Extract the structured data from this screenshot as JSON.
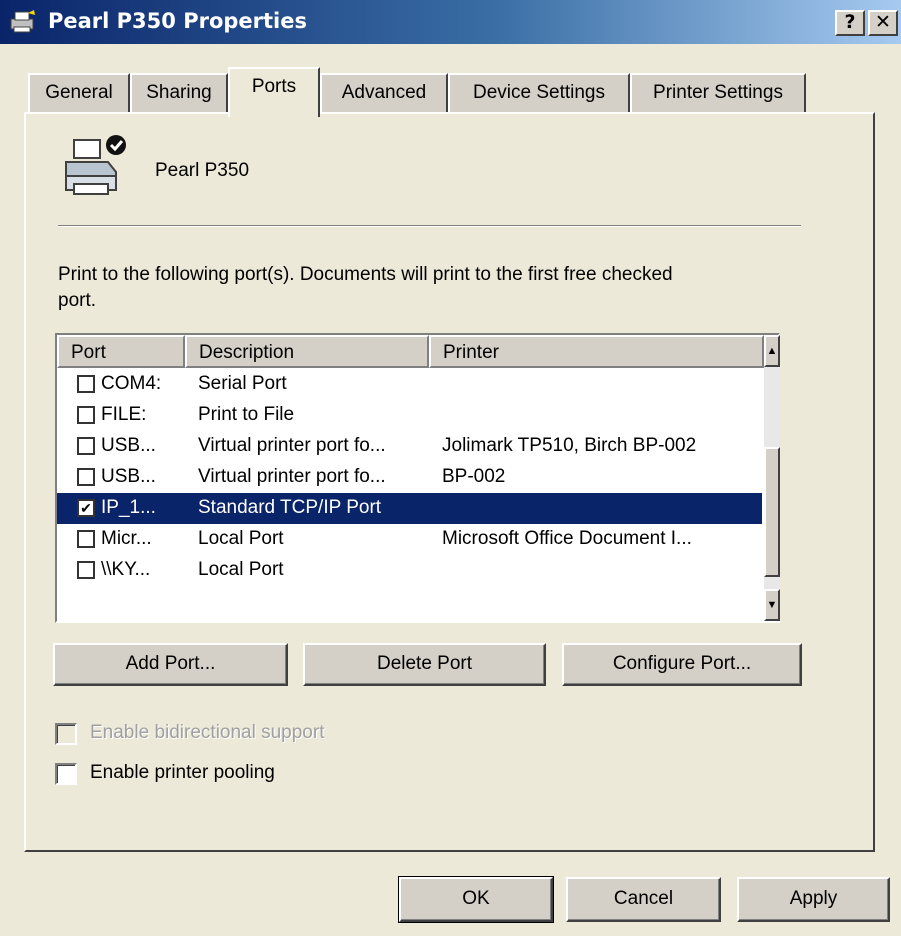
{
  "window": {
    "title": "Pearl P350 Properties",
    "help_label": "?",
    "close_label": "✕"
  },
  "tabs": [
    {
      "label": "General"
    },
    {
      "label": "Sharing"
    },
    {
      "label": "Ports",
      "active": true
    },
    {
      "label": "Advanced"
    },
    {
      "label": "Device Settings"
    },
    {
      "label": "Printer Settings"
    }
  ],
  "printer": {
    "name": "Pearl P350",
    "icon": "printer-default-icon"
  },
  "instructions": "Print to the following port(s). Documents will print to the first free checked port.",
  "ports_table": {
    "columns": [
      "Port",
      "Description",
      "Printer"
    ],
    "rows": [
      {
        "port": "COM4:",
        "description": "Serial Port",
        "printer": "",
        "checked": false,
        "selected": false
      },
      {
        "port": "FILE:",
        "description": "Print to File",
        "printer": "",
        "checked": false,
        "selected": false
      },
      {
        "port": "USB...",
        "description": "Virtual printer port fo...",
        "printer": "Jolimark TP510, Birch BP-002",
        "checked": false,
        "selected": false
      },
      {
        "port": "USB...",
        "description": "Virtual printer port fo...",
        "printer": "BP-002",
        "checked": false,
        "selected": false
      },
      {
        "port": "IP_1...",
        "description": "Standard TCP/IP Port",
        "printer": "",
        "checked": true,
        "selected": true
      },
      {
        "port": "Micr...",
        "description": "Local Port",
        "printer": "Microsoft Office Document I...",
        "checked": false,
        "selected": false
      },
      {
        "port": "\\\\KY...",
        "description": "Local Port",
        "printer": "",
        "checked": false,
        "selected": false
      }
    ]
  },
  "port_buttons": {
    "add": "Add Port...",
    "delete": "Delete Port",
    "configure": "Configure Port..."
  },
  "options": {
    "bidirectional": {
      "label": "Enable bidirectional support",
      "checked": false,
      "enabled": false
    },
    "pooling": {
      "label": "Enable printer pooling",
      "checked": false,
      "enabled": true
    }
  },
  "dialog_buttons": {
    "ok": "OK",
    "cancel": "Cancel",
    "apply": "Apply"
  }
}
